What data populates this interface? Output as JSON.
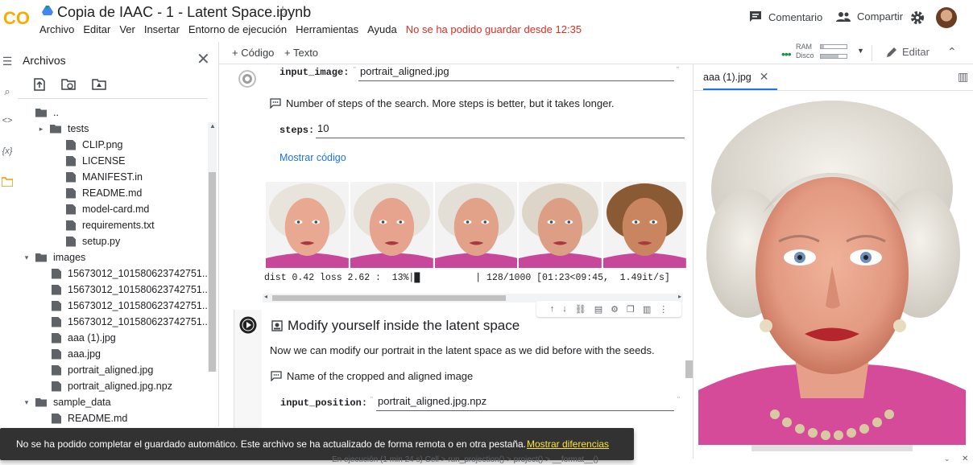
{
  "header": {
    "logo_text": "CO",
    "title": "Copia de IAAC - 1 - Latent Space.ipynb",
    "menu": [
      "Archivo",
      "Editar",
      "Ver",
      "Insertar",
      "Entorno de ejecución",
      "Herramientas",
      "Ayuda"
    ],
    "save_warning": "No se ha podido guardar desde 12:35",
    "comment_label": "Comentario",
    "share_label": "Compartir"
  },
  "toolbar": {
    "add_code": "+ Código",
    "add_text": "+ Texto",
    "ram_label": "RAM",
    "disk_label": "Disco",
    "ram_fill": 0.12,
    "disk_fill": 0.7,
    "edit_label": "Editar"
  },
  "sidebar": {
    "title": "Archivos",
    "tree": [
      {
        "label": "..",
        "type": "folder-up",
        "indent": 0
      },
      {
        "label": "tests",
        "type": "folder",
        "indent": 1,
        "caret": "▸"
      },
      {
        "label": "CLIP.png",
        "type": "file",
        "indent": 2
      },
      {
        "label": "LICENSE",
        "type": "file",
        "indent": 2
      },
      {
        "label": "MANIFEST.in",
        "type": "file",
        "indent": 2
      },
      {
        "label": "README.md",
        "type": "file",
        "indent": 2
      },
      {
        "label": "model-card.md",
        "type": "file",
        "indent": 2
      },
      {
        "label": "requirements.txt",
        "type": "file",
        "indent": 2
      },
      {
        "label": "setup.py",
        "type": "file",
        "indent": 2
      },
      {
        "label": "images",
        "type": "folder",
        "indent": 0,
        "caret": "▾"
      },
      {
        "label": "15673012_101580623742751...",
        "type": "file",
        "indent": 1
      },
      {
        "label": "15673012_101580623742751...",
        "type": "file",
        "indent": 1
      },
      {
        "label": "15673012_101580623742751...",
        "type": "file",
        "indent": 1
      },
      {
        "label": "15673012_101580623742751...",
        "type": "file",
        "indent": 1
      },
      {
        "label": "aaa (1).jpg",
        "type": "file",
        "indent": 1
      },
      {
        "label": "aaa.jpg",
        "type": "file",
        "indent": 1
      },
      {
        "label": "portrait_aligned.jpg",
        "type": "file",
        "indent": 1
      },
      {
        "label": "portrait_aligned.jpg.npz",
        "type": "file",
        "indent": 1
      },
      {
        "label": "sample_data",
        "type": "folder",
        "indent": 0,
        "caret": "▾"
      },
      {
        "label": "README.md",
        "type": "file",
        "indent": 1
      }
    ]
  },
  "cell1": {
    "input_image_label": "input_image:",
    "input_image_value": "portrait_aligned.jpg",
    "steps_comment": "Number of steps of the search. More steps is better, but it takes longer.",
    "steps_label": "steps:",
    "steps_value": "10",
    "show_code": "Mostrar código",
    "progress_text": "dist 0.42 loss 2.62 :  13%|█          | 128/1000 [01:23<09:45,  1.49it/s]",
    "progress_fraction": 0.128
  },
  "cell2": {
    "heading": "Modify yourself inside the latent space",
    "description": "Now we can modify our portrait in the latent space as we did before with the seeds.",
    "comment": "Name of the cropped and aligned image",
    "input_position_label": "input_position:",
    "input_position_value": "portrait_aligned.jpg.npz"
  },
  "right_panel": {
    "tab_label": "aaa (1).jpg"
  },
  "toast": {
    "message": "No se ha podido completar el guardado automático. Este archivo se ha actualizado de forma remota o en otra pestaña.",
    "action": "Mostrar diferencias"
  },
  "status": {
    "text": "En ejecución (1 min 24 s)  Cell > run_projection() > project() > __format__()"
  },
  "colors": {
    "accent_blue": "#1a73e8",
    "warning_red": "#d93025",
    "logo_orange": "#f9ab00",
    "toast_action": "#fce43a"
  }
}
